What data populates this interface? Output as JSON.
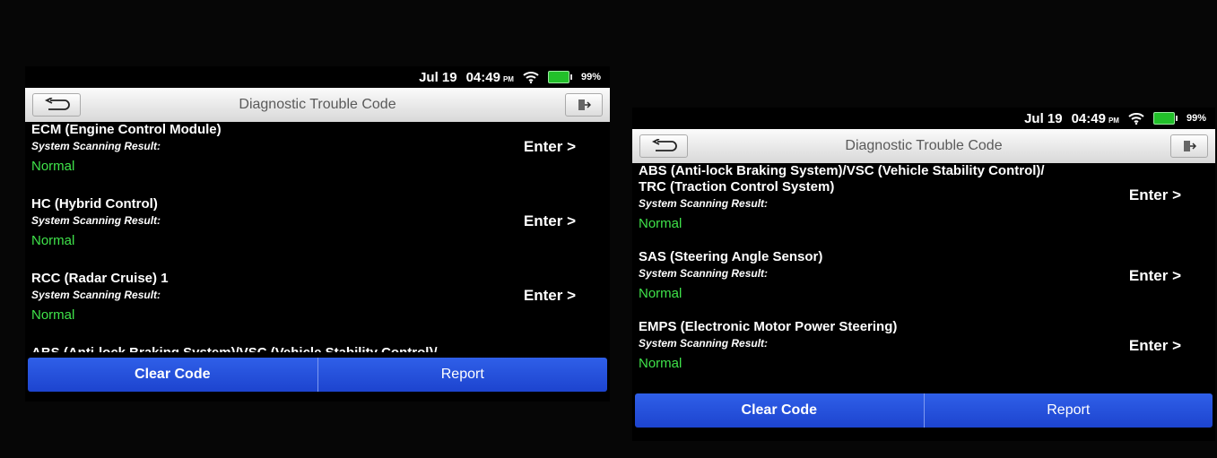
{
  "status": {
    "date": "Jul 19",
    "time": "04:49",
    "ampm": "PM",
    "battery": "99%"
  },
  "header": {
    "title": "Diagnostic Trouble Code"
  },
  "footer": {
    "clear_label": "Clear Code",
    "report_label": "Report"
  },
  "scan_label": "System Scanning Result:",
  "enter_label": "Enter >",
  "left_screen": {
    "items": [
      {
        "name": "ECM (Engine Control Module)",
        "result": "Normal"
      },
      {
        "name": "HC (Hybrid Control)",
        "result": "Normal"
      },
      {
        "name": "RCC (Radar Cruise) 1",
        "result": "Normal"
      },
      {
        "name": "ABS (Anti-lock Braking System)/VSC (Vehicle Stability Control)/"
      }
    ]
  },
  "right_screen": {
    "items": [
      {
        "name_line1": "ABS (Anti-lock Braking System)/VSC (Vehicle Stability Control)/",
        "name_line2": "TRC (Traction Control System)",
        "result": "Normal"
      },
      {
        "name": "SAS (Steering Angle Sensor)",
        "result": "Normal"
      },
      {
        "name": "EMPS (Electronic Motor Power Steering)",
        "result": "Normal"
      }
    ]
  },
  "colors": {
    "normal": "#3fe34a",
    "button": "#2450dc",
    "battery": "#22c02a"
  },
  "icons": {
    "back": "back-arrow-icon",
    "exit": "exit-icon",
    "wifi": "wifi-icon",
    "battery": "battery-icon"
  }
}
